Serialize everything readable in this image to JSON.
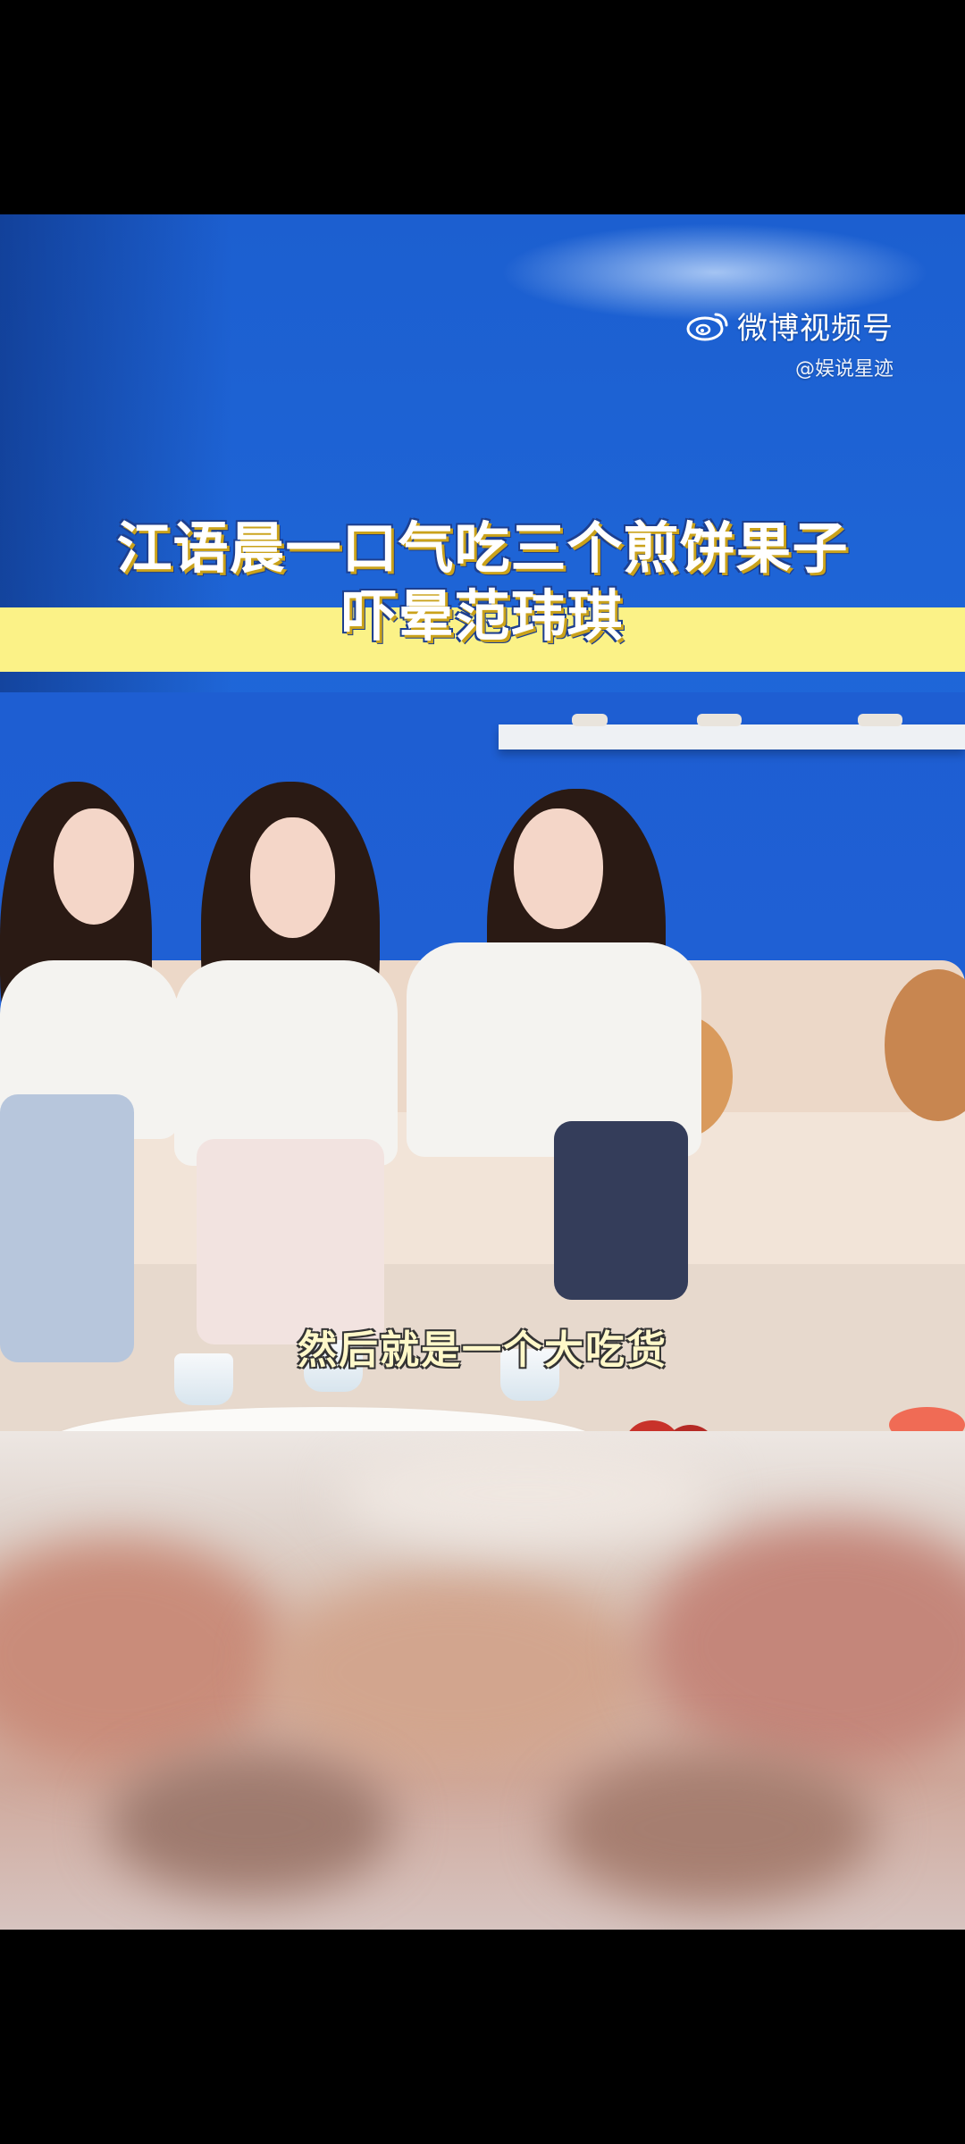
{
  "watermark": {
    "platform": "微博视频号",
    "user": "@娱说星迹",
    "logo_icon": "weibo-logo-icon"
  },
  "title": {
    "line1": "江语晨一口气吃三个煎饼果子",
    "line2": "吓晕范玮琪"
  },
  "subtitle": "然后就是一个大吃货",
  "colors": {
    "banner_yellow": "#fbf287",
    "background_blue": "#1f62d6",
    "title_outline": "#1d3f8f",
    "subtitle_text": "#fff8c9"
  }
}
